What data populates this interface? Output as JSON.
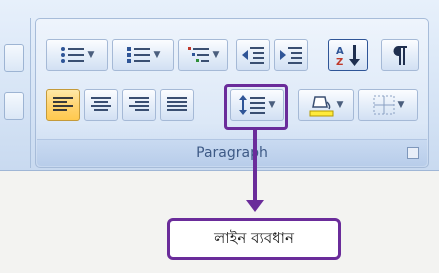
{
  "ribbon": {
    "group_title": "Paragraph",
    "row1": [
      {
        "name": "bullets-button",
        "icon": "bullets-icon",
        "dropdown": true
      },
      {
        "name": "numbering-button",
        "icon": "numbering-icon",
        "dropdown": true
      },
      {
        "name": "multilevel-list-button",
        "icon": "multilevel-list-icon",
        "dropdown": true
      },
      {
        "name": "decrease-indent-button",
        "icon": "decrease-indent-icon",
        "dropdown": false
      },
      {
        "name": "increase-indent-button",
        "icon": "increase-indent-icon",
        "dropdown": false
      },
      {
        "name": "sort-button",
        "icon": "sort-az-icon",
        "dropdown": false
      },
      {
        "name": "show-formatting-button",
        "icon": "pilcrow-icon",
        "dropdown": false
      }
    ],
    "row2": [
      {
        "name": "align-left-button",
        "icon": "align-left-icon",
        "active": true
      },
      {
        "name": "align-center-button",
        "icon": "align-center-icon",
        "active": false
      },
      {
        "name": "align-right-button",
        "icon": "align-right-icon",
        "active": false
      },
      {
        "name": "justify-button",
        "icon": "justify-icon",
        "active": false
      },
      {
        "name": "line-spacing-button",
        "icon": "line-spacing-icon",
        "dropdown": true
      },
      {
        "name": "shading-button",
        "icon": "paint-bucket-icon",
        "dropdown": true
      },
      {
        "name": "borders-button",
        "icon": "borders-icon",
        "dropdown": true
      }
    ]
  },
  "callout": {
    "text": "লাইন ব্যবধান"
  },
  "colors": {
    "annotation": "#6a2c9a",
    "active_button": "#ffd472",
    "ribbon_bg": "#dae7f7",
    "group_title": "#3e5a86"
  }
}
